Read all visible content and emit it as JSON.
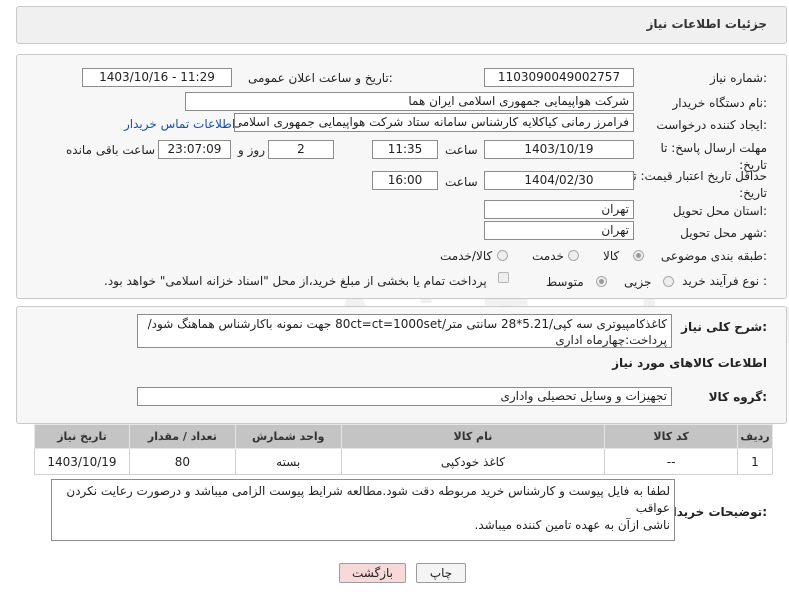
{
  "page_title": "جزئیات اطلاعات نیاز",
  "fields": {
    "need_number_label": "شماره نیاز:",
    "need_number": "1103090049002757",
    "announce_label": "تاریخ و ساعت اعلان عمومی:",
    "announce_value": "1403/10/16 - 11:29",
    "buyer_org_label": "نام دستگاه خریدار:",
    "buyer_org": "شرکت هواپیمایی جمهوری اسلامی ایران هما",
    "creator_label": "ایجاد کننده درخواست:",
    "creator": "فرامرز رمانی کیاکلایه کارشناس سامانه ستاد شرکت هواپیمایی جمهوری اسلامی",
    "contact_link": "اطلاعات تماس خریدار",
    "deadline_label": "مهلت ارسال پاسخ: تا تاریخ:",
    "deadline_date": "1403/10/19",
    "time_label": "ساعت",
    "deadline_time": "11:35",
    "days_value": "2",
    "days_label": "روز و",
    "remaining_time": "23:07:09",
    "remaining_label": "ساعت باقی مانده",
    "validity_label": "حداقل تاریخ اعتبار قیمت: تا تاریخ:",
    "validity_date": "1404/02/30",
    "validity_time": "16:00",
    "province_label": "استان محل تحویل:",
    "province": "تهران",
    "city_label": "شهر محل تحویل:",
    "city": "تهران",
    "category_label": "طبقه بندی موضوعی:",
    "category_options": [
      "کالا",
      "خدمت",
      "کالا/خدمت"
    ],
    "process_label": "نوع فرآیند خرید :",
    "process_options": [
      "جزیی",
      "متوسط"
    ],
    "payment_note": "پرداخت تمام یا بخشی از مبلغ خرید،از محل \"اسناد خزانه اسلامی\" خواهد بود."
  },
  "summary": {
    "label": "شرح کلی نیاز:",
    "text_line1": "کاغذکامپیوتری سه کپی/5.21*28 سانتی متر/80ct=ct=1000set جهت نمونه باکارشناس هماهنگ شود/",
    "text_line2": "پرداخت:چهارماه اداری"
  },
  "goods_info_title": "اطلاعات کالاهای مورد نیاز",
  "goods_group_label": "گروه کالا:",
  "goods_group": "تجهیزات و وسایل تحصیلی واداری",
  "table": {
    "headers": [
      "ردیف",
      "کد کالا",
      "نام کالا",
      "واحد شمارش",
      "تعداد / مقدار",
      "تاریخ نیاز"
    ],
    "rows": [
      [
        "1",
        "--",
        "کاغذ خودکپی",
        "بسته",
        "80",
        "1403/10/19"
      ]
    ]
  },
  "buyer_notes_label": "توضیحات خریدار:",
  "buyer_notes_line1": "لطفا به فایل پیوست و کارشناس خرید مربوطه دقت شود.مطالعه شرایط پیوست الزامی میباشد و درصورت رعایت نکردن عواقب",
  "buyer_notes_line2": "ناشی ازآن به عهده تامین کننده میباشد.",
  "buttons": {
    "print": "چاپ",
    "back": "بازگشت"
  },
  "colors": {
    "back_button_bg": "#f7d9d9",
    "link": "#1a4fa0"
  }
}
